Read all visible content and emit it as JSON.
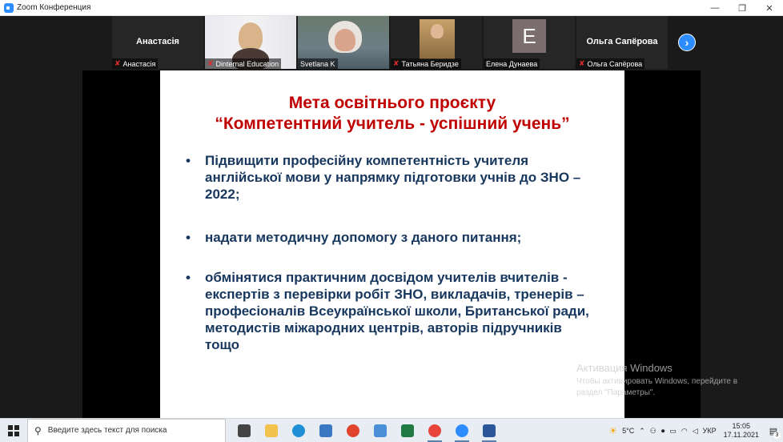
{
  "window": {
    "title": "Zoom Конференция",
    "minimize": "—",
    "restore": "❐",
    "close": "✕"
  },
  "participants": [
    {
      "name": "Анастасія",
      "center_label": "Анастасія",
      "muted": true,
      "video": false
    },
    {
      "name": "Dinternal Education",
      "muted": true,
      "video": true
    },
    {
      "name": "Svetlana K",
      "muted": false,
      "video": true,
      "active_speaker": true
    },
    {
      "name": "Татьяна Беридзе",
      "muted": true,
      "video": true
    },
    {
      "name": "Елена Дунаева",
      "avatar_letter": "E",
      "muted": false,
      "video": false
    },
    {
      "name": "Ольга Сапёрова",
      "center_label": "Ольга Сапёрова",
      "muted": true,
      "video": false
    }
  ],
  "next_button": "›",
  "slide": {
    "title_line1": "Мета освітнього проєкту",
    "title_line2": "“Компетентний учитель - успішний учень”",
    "bullet_symbol": "•",
    "bullets": [
      {
        "lines": [
          "Підвищити професійну компетентність учителя",
          "англійської мови у напрямку підготовки учнів до ЗНО –",
          "2022;"
        ]
      },
      {
        "lines": [
          "надати методичну допомогу з даного питання;"
        ]
      },
      {
        "lines": [
          "обмінятися практичним досвідом учителів вчителів -",
          "експертів з перевірки робіт ЗНО, викладачів, тренерів –",
          "професіоналів Всеукраїнської школи, Британської ради,",
          "методистів міжародних центрів, авторів підручників",
          "тощо"
        ]
      }
    ]
  },
  "activation": {
    "title": "Активация Windows",
    "line1": "Чтобы активировать Windows, перейдите в",
    "line2": "раздел \"Параметры\"."
  },
  "taskbar": {
    "search_placeholder": "Введите здесь текст для поиска",
    "apps": [
      {
        "icon": "task-view-icon",
        "color": "#444444",
        "running": false
      },
      {
        "icon": "file-explorer-icon",
        "color": "#f2c14e",
        "running": false
      },
      {
        "icon": "edge-icon",
        "color": "#1f8fd6",
        "running": false
      },
      {
        "icon": "app-blue-icon",
        "color": "#3a78c2",
        "running": false
      },
      {
        "icon": "yandex-icon",
        "color": "#e0442c",
        "running": false
      },
      {
        "icon": "photos-icon",
        "color": "#4a90d9",
        "running": false
      },
      {
        "icon": "excel-icon",
        "color": "#1f7a44",
        "running": false
      },
      {
        "icon": "chrome-icon",
        "color": "#e8453c",
        "running": true
      },
      {
        "icon": "zoom-icon",
        "color": "#2d8cff",
        "running": true
      },
      {
        "icon": "word-icon",
        "color": "#2b579a",
        "running": true
      }
    ],
    "weather": "5°C",
    "language": "УКР",
    "time": "15:05",
    "date": "17.11.2021",
    "notifications_count": "3"
  }
}
